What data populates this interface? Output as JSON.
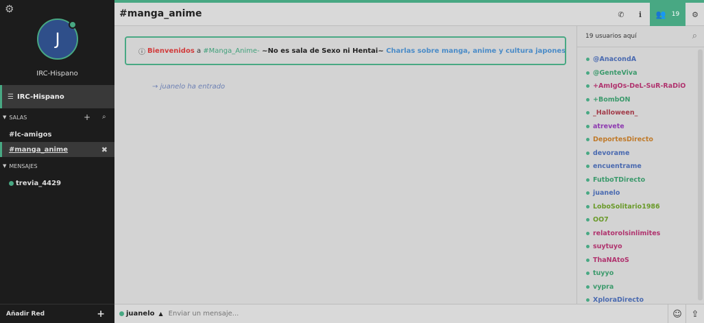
{
  "sidebar": {
    "network_name": "IRC-Hispano",
    "avatar_letter": "J",
    "network_row": "IRC-Hispano",
    "rooms_label": "SALAS",
    "channels": [
      "#lc-amigos",
      "#manga_anime"
    ],
    "active_channel": "#manga_anime",
    "messages_label": "MENSAJES",
    "queries": [
      "trevia_4429"
    ],
    "add_network": "Añadir Red"
  },
  "header": {
    "channel_title": "#manga_anime",
    "user_count": "19"
  },
  "topic": {
    "welcome": "Bienvenidos",
    "to": " a ",
    "channel": "#Manga_Anime-",
    "warning": " ~No es sala de Sexo ni Hentai~ ",
    "description": "Charlas sobre manga, anime y cultura japonesa"
  },
  "messages": {
    "join_arrow": "→",
    "join_nick": "juanelo",
    "join_text": "ha entrado"
  },
  "users_panel": {
    "heading": "19 usuarios aquí",
    "users": [
      {
        "name": "@AnacondA",
        "color": "#4a6ab0"
      },
      {
        "name": "@GenteViva",
        "color": "#3c9a6c"
      },
      {
        "name": "+AmIgOs-DeL-SuR-RaDiO",
        "color": "#b0336e"
      },
      {
        "name": "+BombON",
        "color": "#3c9a6c"
      },
      {
        "name": "_Halloween_",
        "color": "#a23c4a"
      },
      {
        "name": "atrevete",
        "color": "#8e3ab0"
      },
      {
        "name": "DeportesDirecto",
        "color": "#c07a2a"
      },
      {
        "name": "devorame",
        "color": "#4a6ab0"
      },
      {
        "name": "encuentrame",
        "color": "#4a6ab0"
      },
      {
        "name": "FutboTDirecto",
        "color": "#3c9a6c"
      },
      {
        "name": "juanelo",
        "color": "#4a6ab0"
      },
      {
        "name": "LoboSolitario1986",
        "color": "#6a9a2a"
      },
      {
        "name": "OO7",
        "color": "#6a9a2a"
      },
      {
        "name": "relatorolsinlimites",
        "color": "#b0336e"
      },
      {
        "name": "suytuyo",
        "color": "#b0336e"
      },
      {
        "name": "ThaNAtoS",
        "color": "#b0336e"
      },
      {
        "name": "tuyyo",
        "color": "#3c9a6c"
      },
      {
        "name": "vypra",
        "color": "#3c9a6c"
      },
      {
        "name": "XploraDirecto",
        "color": "#4a6ab0"
      }
    ]
  },
  "input": {
    "nick": "juanelo",
    "placeholder": "Enviar un mensaje..."
  },
  "colors": {
    "accent": "#48a883",
    "sidebar_bg": "#1c1c1c"
  }
}
